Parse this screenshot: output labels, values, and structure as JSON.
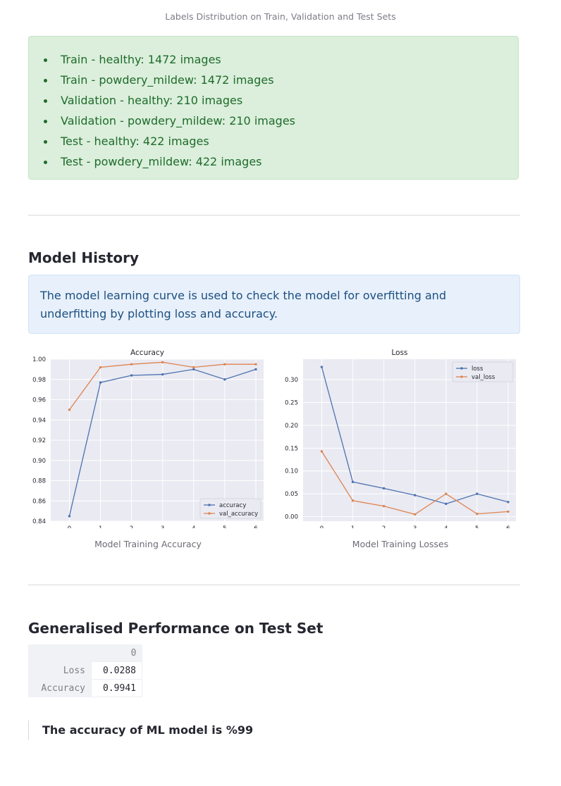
{
  "page": {
    "top_caption": "Labels Distribution on Train, Validation and Test Sets",
    "label_counts": [
      "Train - healthy: 1472 images",
      "Train - powdery_mildew: 1472 images",
      "Validation - healthy: 210 images",
      "Validation - powdery_mildew: 210 images",
      "Test - healthy: 422 images",
      "Test - powdery_mildew: 422 images"
    ],
    "model_history_heading": "Model History",
    "model_history_info": "The model learning curve is used to check the model for overfitting and underfitting by plotting loss and accuracy.",
    "accuracy_caption": "Model Training Accuracy",
    "loss_caption": "Model Training Losses",
    "performance_heading": "Generalised Performance on Test Set",
    "table": {
      "column_header": "0",
      "rows": [
        {
          "label": "Loss",
          "value": "0.0288"
        },
        {
          "label": "Accuracy",
          "value": "0.9941"
        }
      ]
    },
    "accuracy_statement": "The accuracy of ML model is %99"
  },
  "colors": {
    "series_blue": "#4c72b0",
    "series_orange": "#dd8452",
    "plot_bg": "#eaeaf2",
    "success_bg": "#dbefdc",
    "info_bg": "#e7f0fb"
  },
  "chart_data": [
    {
      "type": "line",
      "title": "Accuracy",
      "x": [
        0,
        1,
        2,
        3,
        4,
        5,
        6
      ],
      "ylim": [
        0.84,
        1.0
      ],
      "yticks": [
        "0.84",
        "0.86",
        "0.88",
        "0.90",
        "0.92",
        "0.94",
        "0.96",
        "0.98",
        "1.00"
      ],
      "xticks": [
        "0",
        "1",
        "2",
        "3",
        "4",
        "5",
        "6"
      ],
      "legend_position": "bottom-right",
      "grid": true,
      "series": [
        {
          "name": "accuracy",
          "values": [
            0.845,
            0.977,
            0.984,
            0.985,
            0.99,
            0.98,
            0.99
          ]
        },
        {
          "name": "val_accuracy",
          "values": [
            0.95,
            0.992,
            0.995,
            0.997,
            0.992,
            0.995,
            0.995
          ]
        }
      ]
    },
    {
      "type": "line",
      "title": "Loss",
      "x": [
        0,
        1,
        2,
        3,
        4,
        5,
        6
      ],
      "ylim": [
        -0.01,
        0.345
      ],
      "yticks": [
        "0.00",
        "0.05",
        "0.10",
        "0.15",
        "0.20",
        "0.25",
        "0.30"
      ],
      "xticks": [
        "0",
        "1",
        "2",
        "3",
        "4",
        "5",
        "6"
      ],
      "legend_position": "top-right",
      "grid": true,
      "series": [
        {
          "name": "loss",
          "values": [
            0.328,
            0.076,
            0.062,
            0.047,
            0.028,
            0.05,
            0.032
          ]
        },
        {
          "name": "val_loss",
          "values": [
            0.143,
            0.035,
            0.023,
            0.005,
            0.05,
            0.006,
            0.011
          ]
        }
      ]
    }
  ]
}
